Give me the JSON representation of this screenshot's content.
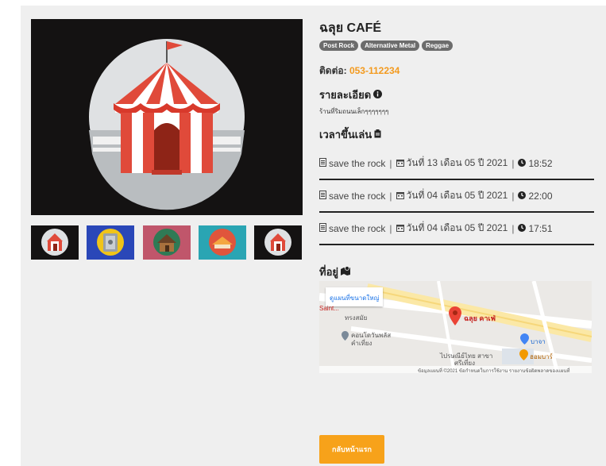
{
  "cafe": {
    "name": "ฉลุย CAFÉ",
    "tags": [
      "Post Rock",
      "Alternative Metal",
      "Reggae"
    ],
    "contact_label": "ติดต่อ:",
    "phone": "053-112234"
  },
  "details": {
    "heading": "รายละเอียด",
    "text": "ร้านที่ริมถนนเล็กๆๆๆๆๆๆๆ"
  },
  "showtimes": {
    "heading": "เวลาขึ้นเล่น",
    "rows": [
      {
        "band": "save the rock",
        "date": "วันที่ 13 เดือน 05 ปี 2021",
        "time": "18:52"
      },
      {
        "band": "save the rock",
        "date": "วันที่ 04 เดือน 05 ปี 2021",
        "time": "22:00"
      },
      {
        "band": "save the rock",
        "date": "วันที่ 04 เดือน 05 ปี 2021",
        "time": "17:51"
      }
    ]
  },
  "address": {
    "heading": "ที่อยู่",
    "map": {
      "view_larger": "ดูแผนที่ขนาดใหญ่",
      "pin_label": "ฉลุย คาเฟ่",
      "places": [
        "ทรงสมัย",
        "คอนโดวันพลัส",
        "คำเที่ยง",
        "บาจา",
        "ฮอมบาร์",
        "ไปรษณีย์ไทย สาขา",
        "ศรีเที่ยง",
        "Saint..."
      ],
      "footer": "ข้อมูลแผนที่ ©2021  ข้อกำหนดในการใช้งาน  รายงานข้อผิดพลาดของแผนที่"
    }
  },
  "actions": {
    "home": "กลับหน้าแรก"
  },
  "colors": {
    "accent": "#f7a21a",
    "phone": "#f39a1e",
    "tag": "#6c6c6c"
  }
}
